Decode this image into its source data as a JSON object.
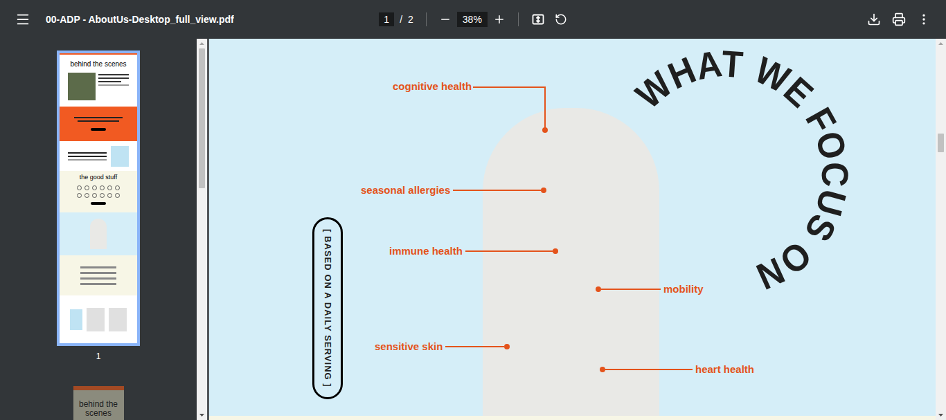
{
  "toolbar": {
    "title": "00-ADP - AboutUs-Desktop_full_view.pdf",
    "page_current": "1",
    "page_separator": "/",
    "page_total": "2",
    "zoom": "38%"
  },
  "thumbnails": [
    {
      "label": "1",
      "selected": true,
      "heading": "behind the scenes",
      "subheading": "the good stuff"
    },
    {
      "selected": false,
      "heading": "behind the scenes"
    }
  ],
  "page": {
    "heading": "WHAT WE FOCUS ON",
    "note": "[ BASED ON A DAILY SERVING ]",
    "annotations": [
      {
        "label": "cognitive health",
        "kind": "elbow"
      },
      {
        "label": "seasonal allergies",
        "kind": "left"
      },
      {
        "label": "immune health",
        "kind": "left"
      },
      {
        "label": "mobility",
        "kind": "right"
      },
      {
        "label": "sensitive skin",
        "kind": "left"
      },
      {
        "label": "heart health",
        "kind": "right"
      }
    ]
  }
}
